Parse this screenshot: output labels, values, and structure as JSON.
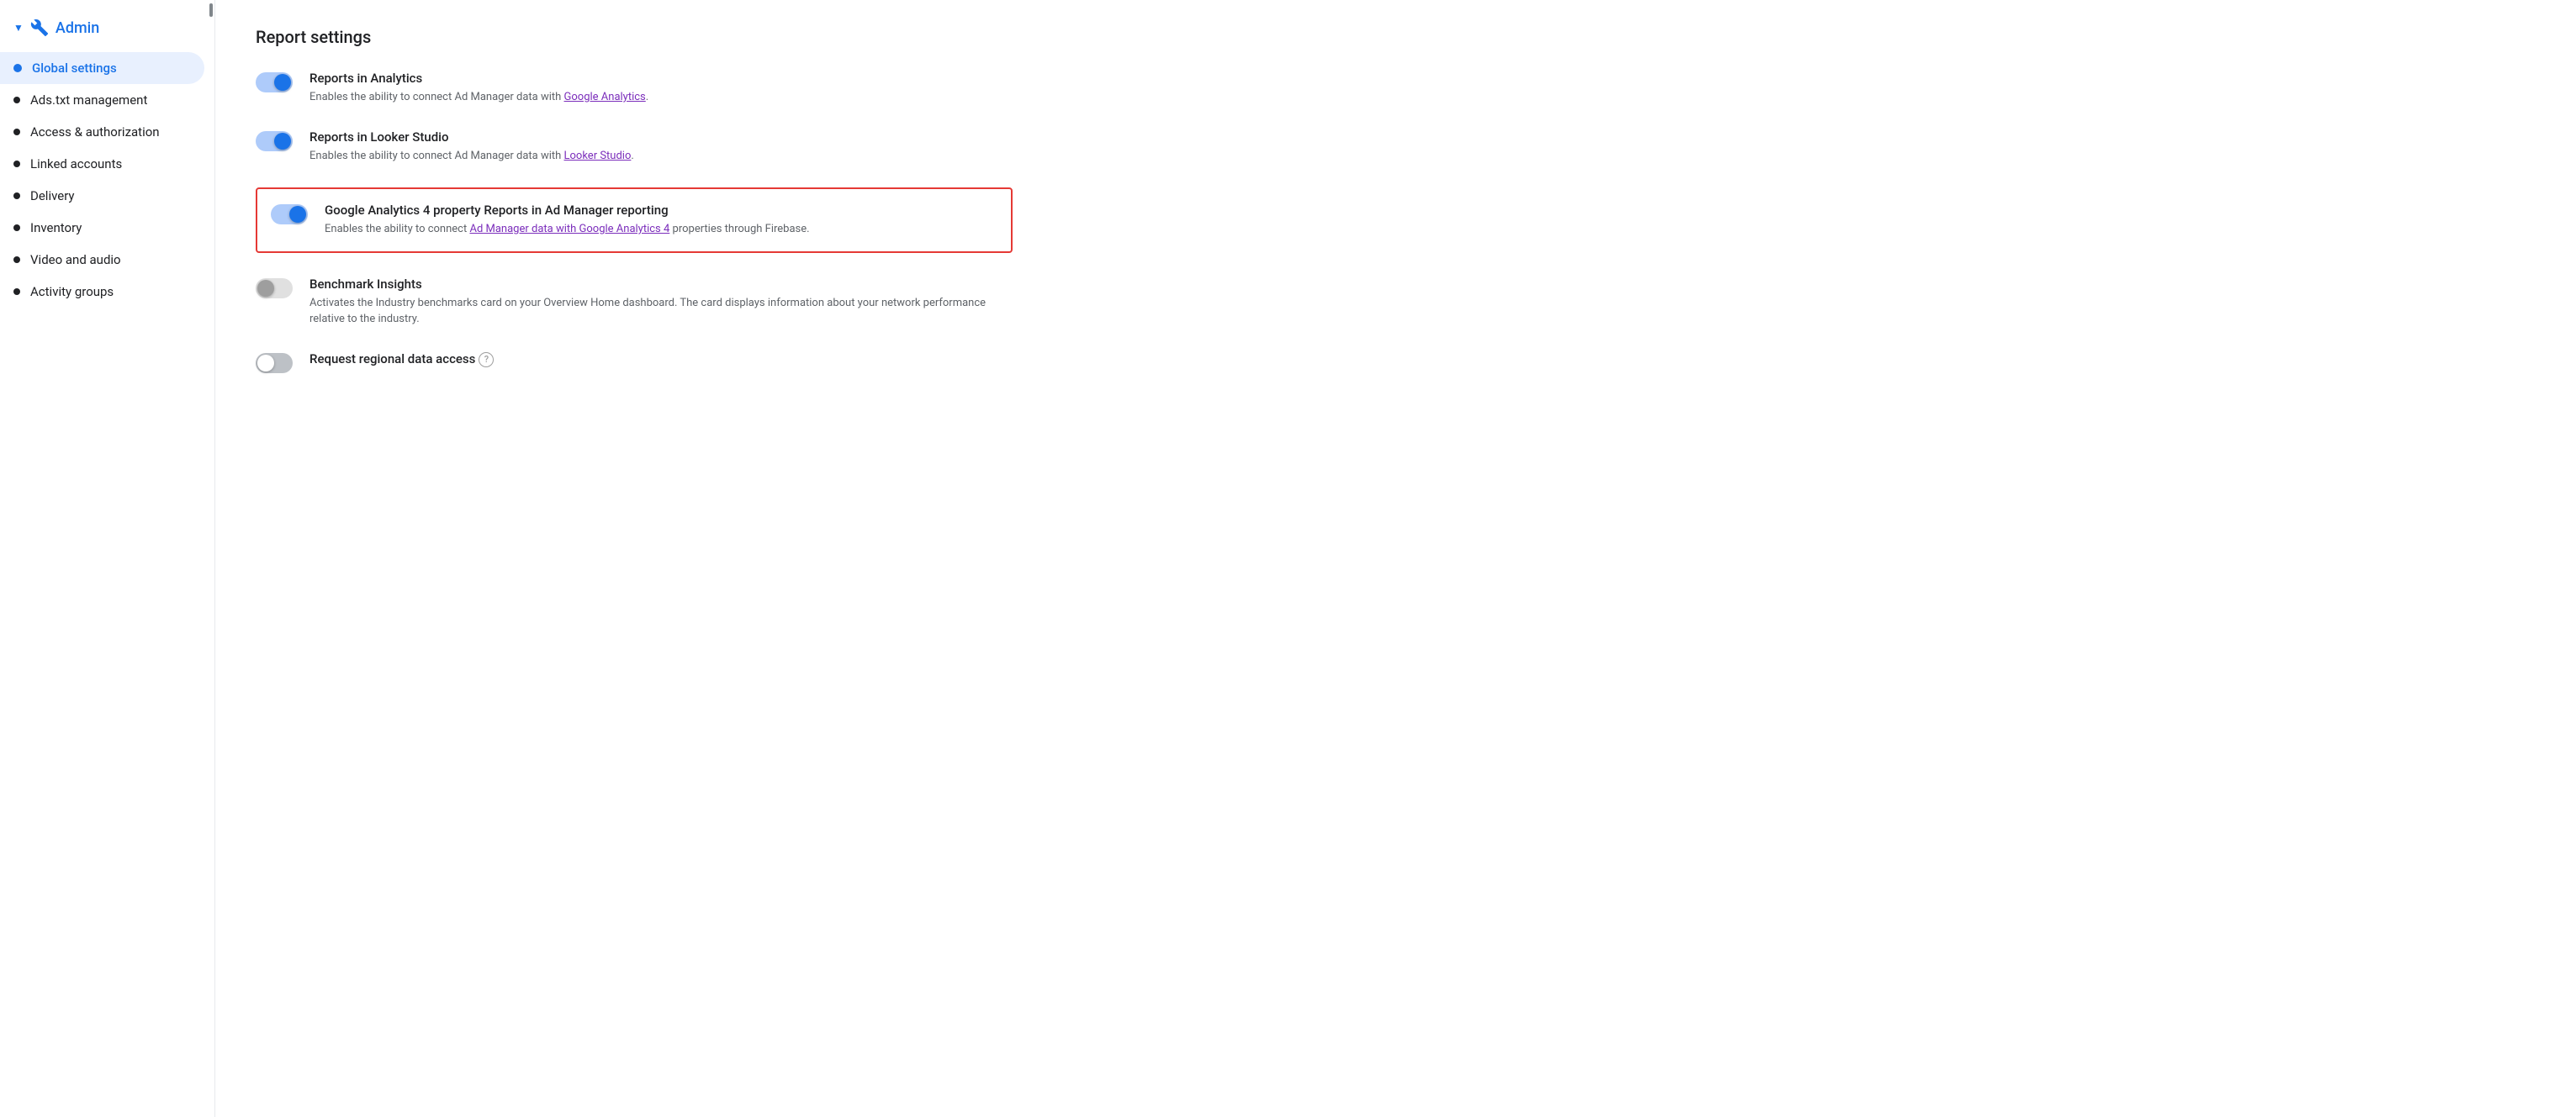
{
  "sidebar": {
    "header_label": "Admin",
    "items": [
      {
        "id": "global-settings",
        "label": "Global settings",
        "active": true
      },
      {
        "id": "ads-txt",
        "label": "Ads.txt management",
        "active": false
      },
      {
        "id": "access-authorization",
        "label": "Access & authorization",
        "active": false
      },
      {
        "id": "linked-accounts",
        "label": "Linked accounts",
        "active": false
      },
      {
        "id": "delivery",
        "label": "Delivery",
        "active": false
      },
      {
        "id": "inventory",
        "label": "Inventory",
        "active": false
      },
      {
        "id": "video-audio",
        "label": "Video and audio",
        "active": false
      },
      {
        "id": "activity-groups",
        "label": "Activity groups",
        "active": false
      }
    ]
  },
  "main": {
    "section_title": "Report settings",
    "settings": [
      {
        "id": "reports-analytics",
        "toggle_state": "on",
        "title": "Reports in Analytics",
        "description": "Enables the ability to connect Ad Manager data with",
        "link_text": "Google Analytics",
        "description_after": ".",
        "highlighted": false
      },
      {
        "id": "reports-looker",
        "toggle_state": "on",
        "title": "Reports in Looker Studio",
        "description": "Enables the ability to connect Ad Manager data with",
        "link_text": "Looker Studio",
        "description_after": ".",
        "highlighted": false
      },
      {
        "id": "ga4-reports",
        "toggle_state": "on",
        "title": "Google Analytics 4 property Reports in Ad Manager reporting",
        "description": "Enables the ability to connect",
        "link_text": "Ad Manager data with Google Analytics 4",
        "description_after": " properties through Firebase.",
        "highlighted": true
      },
      {
        "id": "benchmark-insights",
        "toggle_state": "off-light",
        "title": "Benchmark Insights",
        "description": "Activates the Industry benchmarks card on your Overview Home dashboard. The card displays information about your network performance relative to the industry.",
        "link_text": "",
        "description_after": "",
        "highlighted": false
      },
      {
        "id": "regional-data",
        "toggle_state": "off",
        "title": "Request regional data access",
        "show_help": true,
        "description": "",
        "link_text": "",
        "description_after": "",
        "highlighted": false
      }
    ]
  },
  "colors": {
    "active_blue": "#1a73e8",
    "highlight_red": "#e53935",
    "link_purple": "#7b2dbb"
  }
}
